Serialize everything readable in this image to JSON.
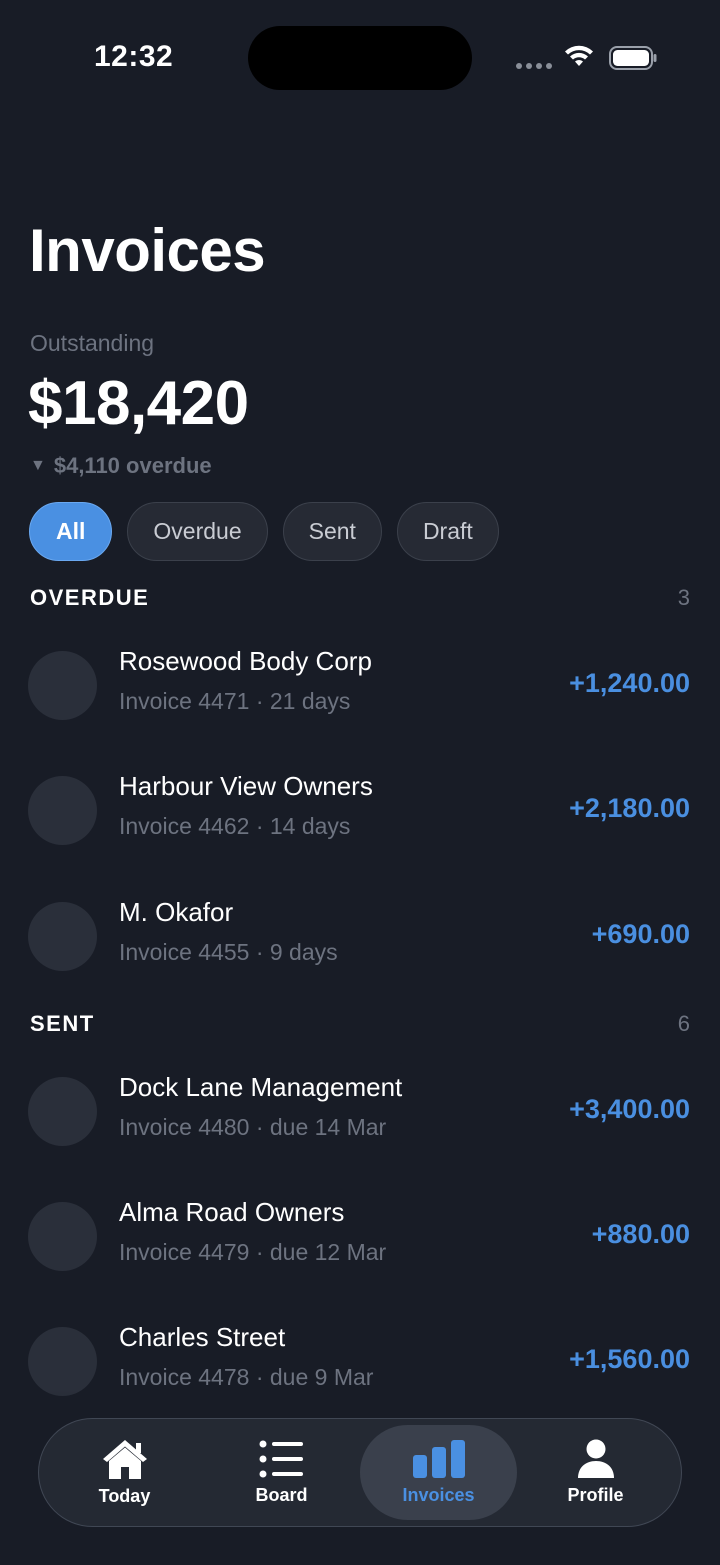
{
  "status_bar": {
    "time": "12:32"
  },
  "header": {
    "title": "Invoices",
    "outstanding_label": "Outstanding",
    "outstanding_value": "$18,420",
    "overdue_arrow": "▼",
    "overdue_note": "$4,110 overdue"
  },
  "filters": [
    {
      "label": "All",
      "active": true
    },
    {
      "label": "Overdue",
      "active": false
    },
    {
      "label": "Sent",
      "active": false
    },
    {
      "label": "Draft",
      "active": false
    }
  ],
  "sections": [
    {
      "title": "OVERDUE",
      "count": "3",
      "rows": [
        {
          "name": "Rosewood Body Corp",
          "sub": "Invoice 4471 · 21 days",
          "amount": "+1,240.00"
        },
        {
          "name": "Harbour View Owners",
          "sub": "Invoice 4462 · 14 days",
          "amount": "+2,180.00"
        },
        {
          "name": "M. Okafor",
          "sub": "Invoice 4455 · 9 days",
          "amount": "+690.00"
        }
      ]
    },
    {
      "title": "SENT",
      "count": "6",
      "rows": [
        {
          "name": "Dock Lane Management",
          "sub": "Invoice 4480 · due 14 Mar",
          "amount": "+3,400.00"
        },
        {
          "name": "Alma Road Owners",
          "sub": "Invoice 4479 · due 12 Mar",
          "amount": "+880.00"
        },
        {
          "name": "Charles Street",
          "sub": "Invoice 4478 · due 9 Mar",
          "amount": "+1,560.00"
        }
      ]
    }
  ],
  "tab_bar": [
    {
      "label": "Today",
      "icon": "house-icon",
      "active": false
    },
    {
      "label": "Board",
      "icon": "list-icon",
      "active": false
    },
    {
      "label": "Invoices",
      "icon": "bar-chart-icon",
      "active": true
    },
    {
      "label": "Profile",
      "icon": "person-icon",
      "active": false
    }
  ],
  "colors": {
    "background": "#181c26",
    "accent": "#4a90e2",
    "amount": "#4a8fe0",
    "muted": "#6d7380"
  }
}
